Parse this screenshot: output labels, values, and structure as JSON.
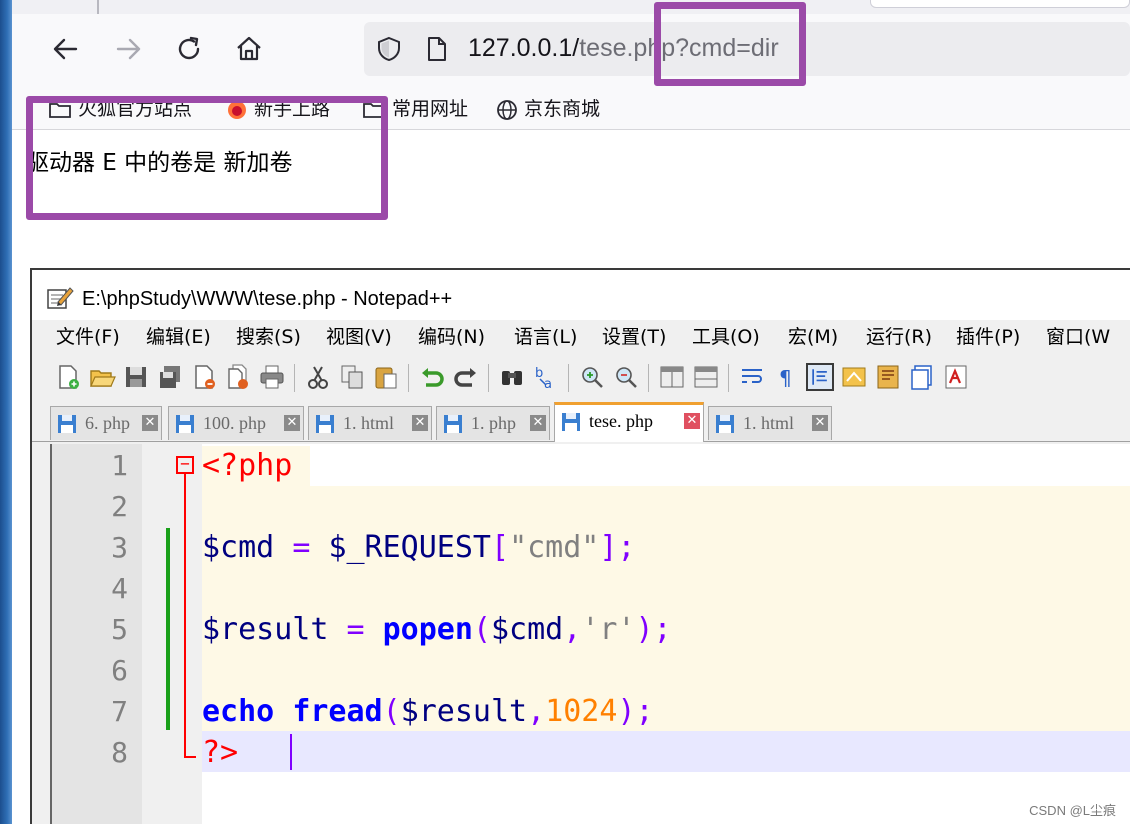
{
  "browser": {
    "url_host": "127.0.0.1/",
    "url_path": "tese.php?cmd=dir",
    "bookmarks": [
      {
        "label": "火狐官方站点",
        "icon": "folder-icon"
      },
      {
        "label": "新手上路",
        "icon": "firefox-icon"
      },
      {
        "label": "常用网址",
        "icon": "folder-icon"
      },
      {
        "label": "京东商城",
        "icon": "globe-icon"
      }
    ],
    "page_output": "驱动器 E 中的卷是 新加卷"
  },
  "notepad": {
    "title": "E:\\phpStudy\\WWW\\tese.php - Notepad++",
    "menu": [
      "文件(F)",
      "编辑(E)",
      "搜索(S)",
      "视图(V)",
      "编码(N)",
      "语言(L)",
      "设置(T)",
      "工具(O)",
      "宏(M)",
      "运行(R)",
      "插件(P)",
      "窗口(W"
    ],
    "tabs": [
      {
        "label": "6. php",
        "active": false
      },
      {
        "label": "100. php",
        "active": false
      },
      {
        "label": "1. html",
        "active": false
      },
      {
        "label": "1. php",
        "active": false
      },
      {
        "label": "tese. php",
        "active": true
      },
      {
        "label": "1. html",
        "active": false
      }
    ],
    "line_numbers": [
      "1",
      "2",
      "3",
      "4",
      "5",
      "6",
      "7",
      "8"
    ],
    "code": {
      "l1": "<?php",
      "l3_var": "$cmd",
      "l3_eq": "=",
      "l3_req": "$_REQUEST",
      "l3_open": "[",
      "l3_str": "\"cmd\"",
      "l3_close": "];",
      "l5_var": "$result",
      "l5_eq": "=",
      "l5_fn": "popen",
      "l5_open": "(",
      "l5_arg": "$cmd",
      "l5_comma": ",",
      "l5_str": "'r'",
      "l5_close": ");",
      "l7_kw": "echo",
      "l7_fn": "fread",
      "l7_open": "(",
      "l7_arg": "$result",
      "l7_comma": ",",
      "l7_num": "1024",
      "l7_close": ");",
      "l8": "?>"
    }
  },
  "watermark": "CSDN @L尘痕",
  "colors": {
    "annotation": "#9b4aa8",
    "keyword": "#0000ff",
    "tag": "#ff0000",
    "number": "#ff8000",
    "operator": "#8000ff"
  }
}
